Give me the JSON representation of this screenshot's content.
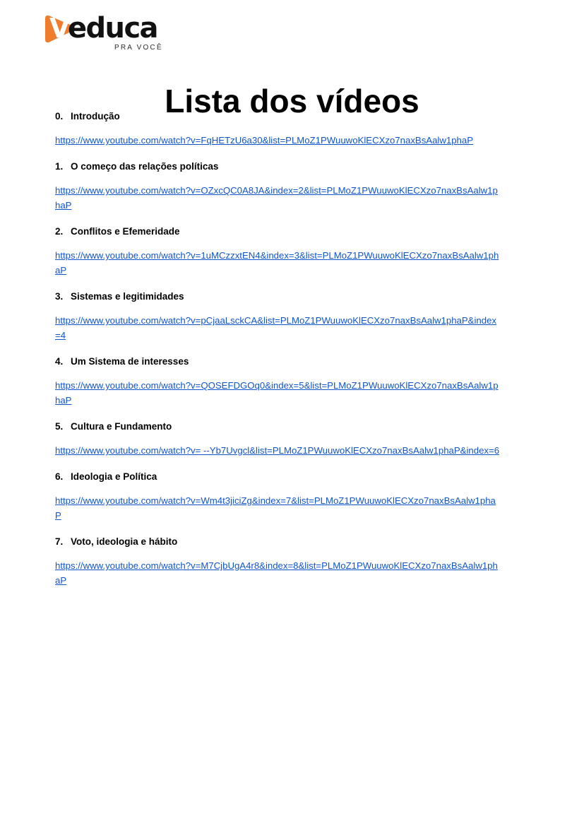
{
  "document": {
    "title": "Lista dos vídeos"
  },
  "logo": {
    "wordmark": "educa",
    "initial": "V",
    "tagline": "PRA VOCÊ",
    "brand_color": "#f07d2e",
    "text_color": "#111111"
  },
  "link_color": "#1155cc",
  "videos": [
    {
      "number": "0.",
      "label": "Introdução",
      "url": "https://www.youtube.com/watch?v=FqHETzU6a30&list=PLMoZ1PWuuwoKlECXzo7naxBsAalw1phaP"
    },
    {
      "number": "1.",
      "label": "O começo das relações políticas",
      "url": "https://www.youtube.com/watch?v=OZxcQC0A8JA&index=2&list=PLMoZ1PWuuwoKlECXzo7naxBsAalw1phaP"
    },
    {
      "number": "2.",
      "label": "Conflitos e Efemeridade",
      "url": "https://www.youtube.com/watch?v=1uMCzzxtEN4&index=3&list=PLMoZ1PWuuwoKlECXzo7naxBsAalw1phaP"
    },
    {
      "number": "3.",
      "label": "Sistemas e legitimidades",
      "url": "https://www.youtube.com/watch?v=pCjaaLsckCA&list=PLMoZ1PWuuwoKlECXzo7naxBsAalw1phaP&index=4"
    },
    {
      "number": "4.",
      "label": "Um Sistema de interesses",
      "url": "https://www.youtube.com/watch?v=QOSEFDGOq0&index=5&list=PLMoZ1PWuuwoKlECXzo7naxBsAalw1phaP"
    },
    {
      "number": "5.",
      "label": "Cultura e Fundamento",
      "url": "https://www.youtube.com/watch?v= --Yb7Uvgcl&list=PLMoZ1PWuuwoKlECXzo7naxBsAalw1phaP&index=6"
    },
    {
      "number": "6.",
      "label": "Ideologia e Política",
      "url": "https://www.youtube.com/watch?v=Wm4t3jiciZg&index=7&list=PLMoZ1PWuuwoKlECXzo7naxBsAalw1phaP"
    },
    {
      "number": "7.",
      "label": "Voto, ideologia e hábito",
      "url": "https://www.youtube.com/watch?v=M7CjbUgA4r8&index=8&list=PLMoZ1PWuuwoKlECXzo7naxBsAalw1phaP"
    }
  ]
}
